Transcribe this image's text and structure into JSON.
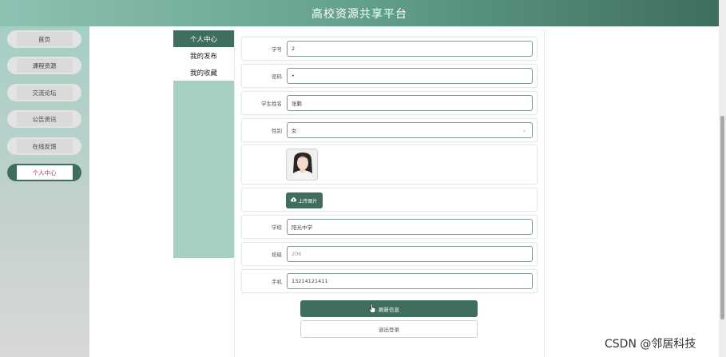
{
  "header": {
    "title": "高校资源共享平台"
  },
  "sidebar": {
    "items": [
      {
        "label": "首页",
        "active": false
      },
      {
        "label": "课程资源",
        "active": false
      },
      {
        "label": "交流论坛",
        "active": false
      },
      {
        "label": "公告资讯",
        "active": false
      },
      {
        "label": "在线反馈",
        "active": false
      },
      {
        "label": "个人中心",
        "active": true
      }
    ]
  },
  "submenu": {
    "items": [
      {
        "label": "个人中心",
        "active": true
      },
      {
        "label": "我的发布",
        "active": false
      },
      {
        "label": "我的收藏",
        "active": false
      }
    ]
  },
  "form": {
    "student_id": {
      "label": "学号",
      "value": "2"
    },
    "password": {
      "label": "密码",
      "value": "•"
    },
    "student_name": {
      "label": "学生姓名",
      "value": "张鹏"
    },
    "gender": {
      "label": "性别",
      "value": "女"
    },
    "upload": {
      "label": "上传图片"
    },
    "school": {
      "label": "学校",
      "value": "阳光中学"
    },
    "class": {
      "label": "班级",
      "placeholder": "206"
    },
    "phone": {
      "label": "手机",
      "value": "13214121411"
    }
  },
  "actions": {
    "refresh_label": "刷新信息",
    "logout_label": "退出登录"
  },
  "watermark": "CSDN @邻居科技",
  "colors": {
    "accent": "#3f6e5e",
    "header_start": "#8ec2b3",
    "submenu_bg": "#a8cfc4",
    "active_text": "#b03a48"
  }
}
